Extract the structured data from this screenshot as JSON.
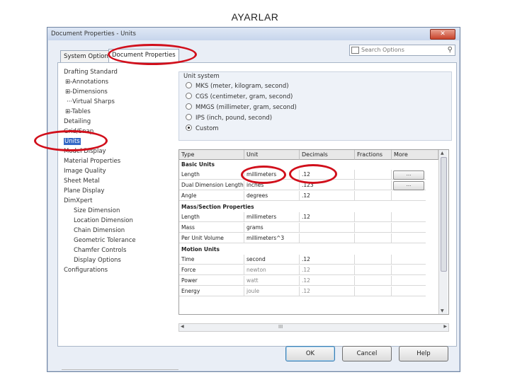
{
  "slide": {
    "title": "AYARLAR"
  },
  "dialog": {
    "title": "Document Properties - Units",
    "close_label": "✕",
    "tabs": [
      "System Options",
      "Document Properties"
    ],
    "search_placeholder": "Search Options"
  },
  "tree": [
    {
      "label": "Drafting Standard"
    },
    {
      "label": "⊞-Annotations"
    },
    {
      "label": "⊞-Dimensions"
    },
    {
      "label": "···Virtual Sharps"
    },
    {
      "label": "⊞-Tables"
    },
    {
      "label": "Detailing"
    },
    {
      "label": "Grid/Snap"
    },
    {
      "label": "Units",
      "selected": true
    },
    {
      "label": "Model Display"
    },
    {
      "label": "Material Properties"
    },
    {
      "label": "Image Quality"
    },
    {
      "label": "Sheet Metal"
    },
    {
      "label": "Plane Display"
    },
    {
      "label": "DimXpert"
    },
    {
      "label": "Size Dimension"
    },
    {
      "label": "Location Dimension"
    },
    {
      "label": "Chain Dimension"
    },
    {
      "label": "Geometric Tolerance"
    },
    {
      "label": "Chamfer Controls"
    },
    {
      "label": "Display Options"
    },
    {
      "label": "Configurations"
    }
  ],
  "unit_system": {
    "title": "Unit system",
    "options": [
      {
        "label": "MKS  (meter, kilogram, second)",
        "selected": false
      },
      {
        "label": "CGS  (centimeter, gram, second)",
        "selected": false
      },
      {
        "label": "MMGS (millimeter, gram, second)",
        "selected": false
      },
      {
        "label": "IPS  (inch, pound, second)",
        "selected": false
      },
      {
        "label": "Custom",
        "selected": true
      }
    ]
  },
  "grid": {
    "headers": [
      "Type",
      "Unit",
      "Decimals",
      "Fractions",
      "More"
    ],
    "sections": [
      {
        "title": "Basic Units",
        "rows": [
          {
            "type": "Length",
            "unit": "millimeters",
            "decimals": ".12",
            "more": "..."
          },
          {
            "type": "Dual Dimension Length",
            "unit": "inches",
            "decimals": ".123",
            "more": "..."
          },
          {
            "type": "Angle",
            "unit": "degrees",
            "decimals": ".12"
          }
        ]
      },
      {
        "title": "Mass/Section Properties",
        "rows": [
          {
            "type": "Length",
            "unit": "millimeters",
            "decimals": ".12"
          },
          {
            "type": "Mass",
            "unit": "grams",
            "decimals": ""
          },
          {
            "type": "Per Unit Volume",
            "unit": "millimeters^3",
            "decimals": ""
          }
        ]
      },
      {
        "title": "Motion Units",
        "rows": [
          {
            "type": "Time",
            "unit": "second",
            "decimals": ".12"
          },
          {
            "type": "Force",
            "unit": "newton",
            "decimals": ".12"
          },
          {
            "type": "Power",
            "unit": "watt",
            "decimals": ".12"
          },
          {
            "type": "Energy",
            "unit": "joule",
            "decimals": ".12"
          }
        ]
      }
    ]
  },
  "buttons": {
    "ok": "OK",
    "cancel": "Cancel",
    "help": "Help"
  },
  "scroll": {
    "grip": "III",
    "left": "◀",
    "right": "▶",
    "up": "▲",
    "down": "▼"
  },
  "highlight_color": "#d10f1b"
}
